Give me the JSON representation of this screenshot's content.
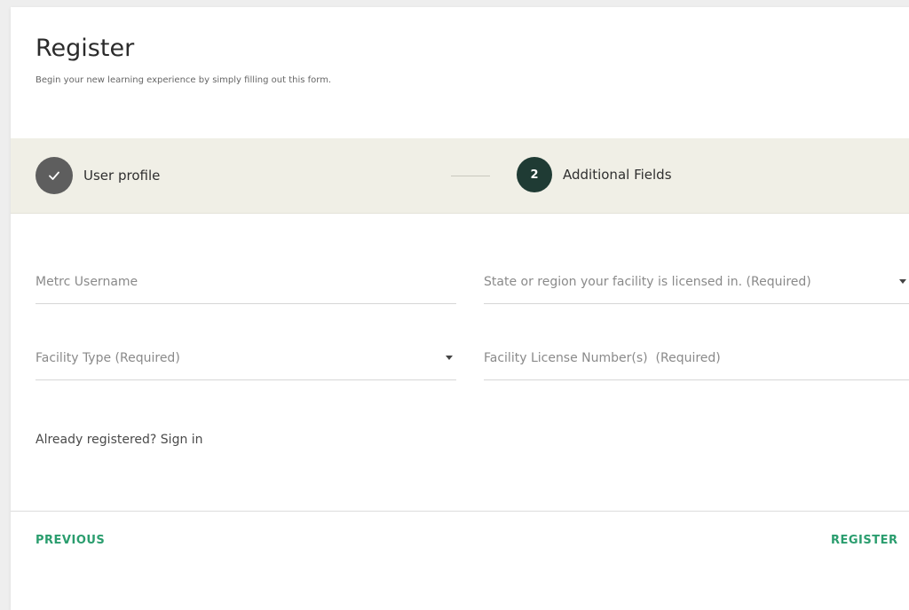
{
  "header": {
    "title": "Register",
    "subtitle": "Begin your new learning experience by simply filling out this form."
  },
  "stepper": {
    "steps": [
      {
        "label": "User profile",
        "status": "completed",
        "icon": "check-icon"
      },
      {
        "label": "Additional Fields",
        "status": "active",
        "number": "2"
      }
    ]
  },
  "form": {
    "metrc_username_placeholder": "Metrc Username",
    "state_placeholder": "State or region your facility is licensed in. (Required)",
    "facility_type_placeholder": "Facility Type (Required)",
    "license_placeholder": "Facility License Number(s)  (Required)"
  },
  "signin": {
    "prompt": "Already registered?",
    "link": "Sign in"
  },
  "footer": {
    "previous_label": "PREVIOUS",
    "register_label": "REGISTER"
  },
  "colors": {
    "accent": "#2a9d6e",
    "stepper_bg": "#f0efe6",
    "active_step": "#1f3b34",
    "completed_step": "#5e5e5e"
  }
}
